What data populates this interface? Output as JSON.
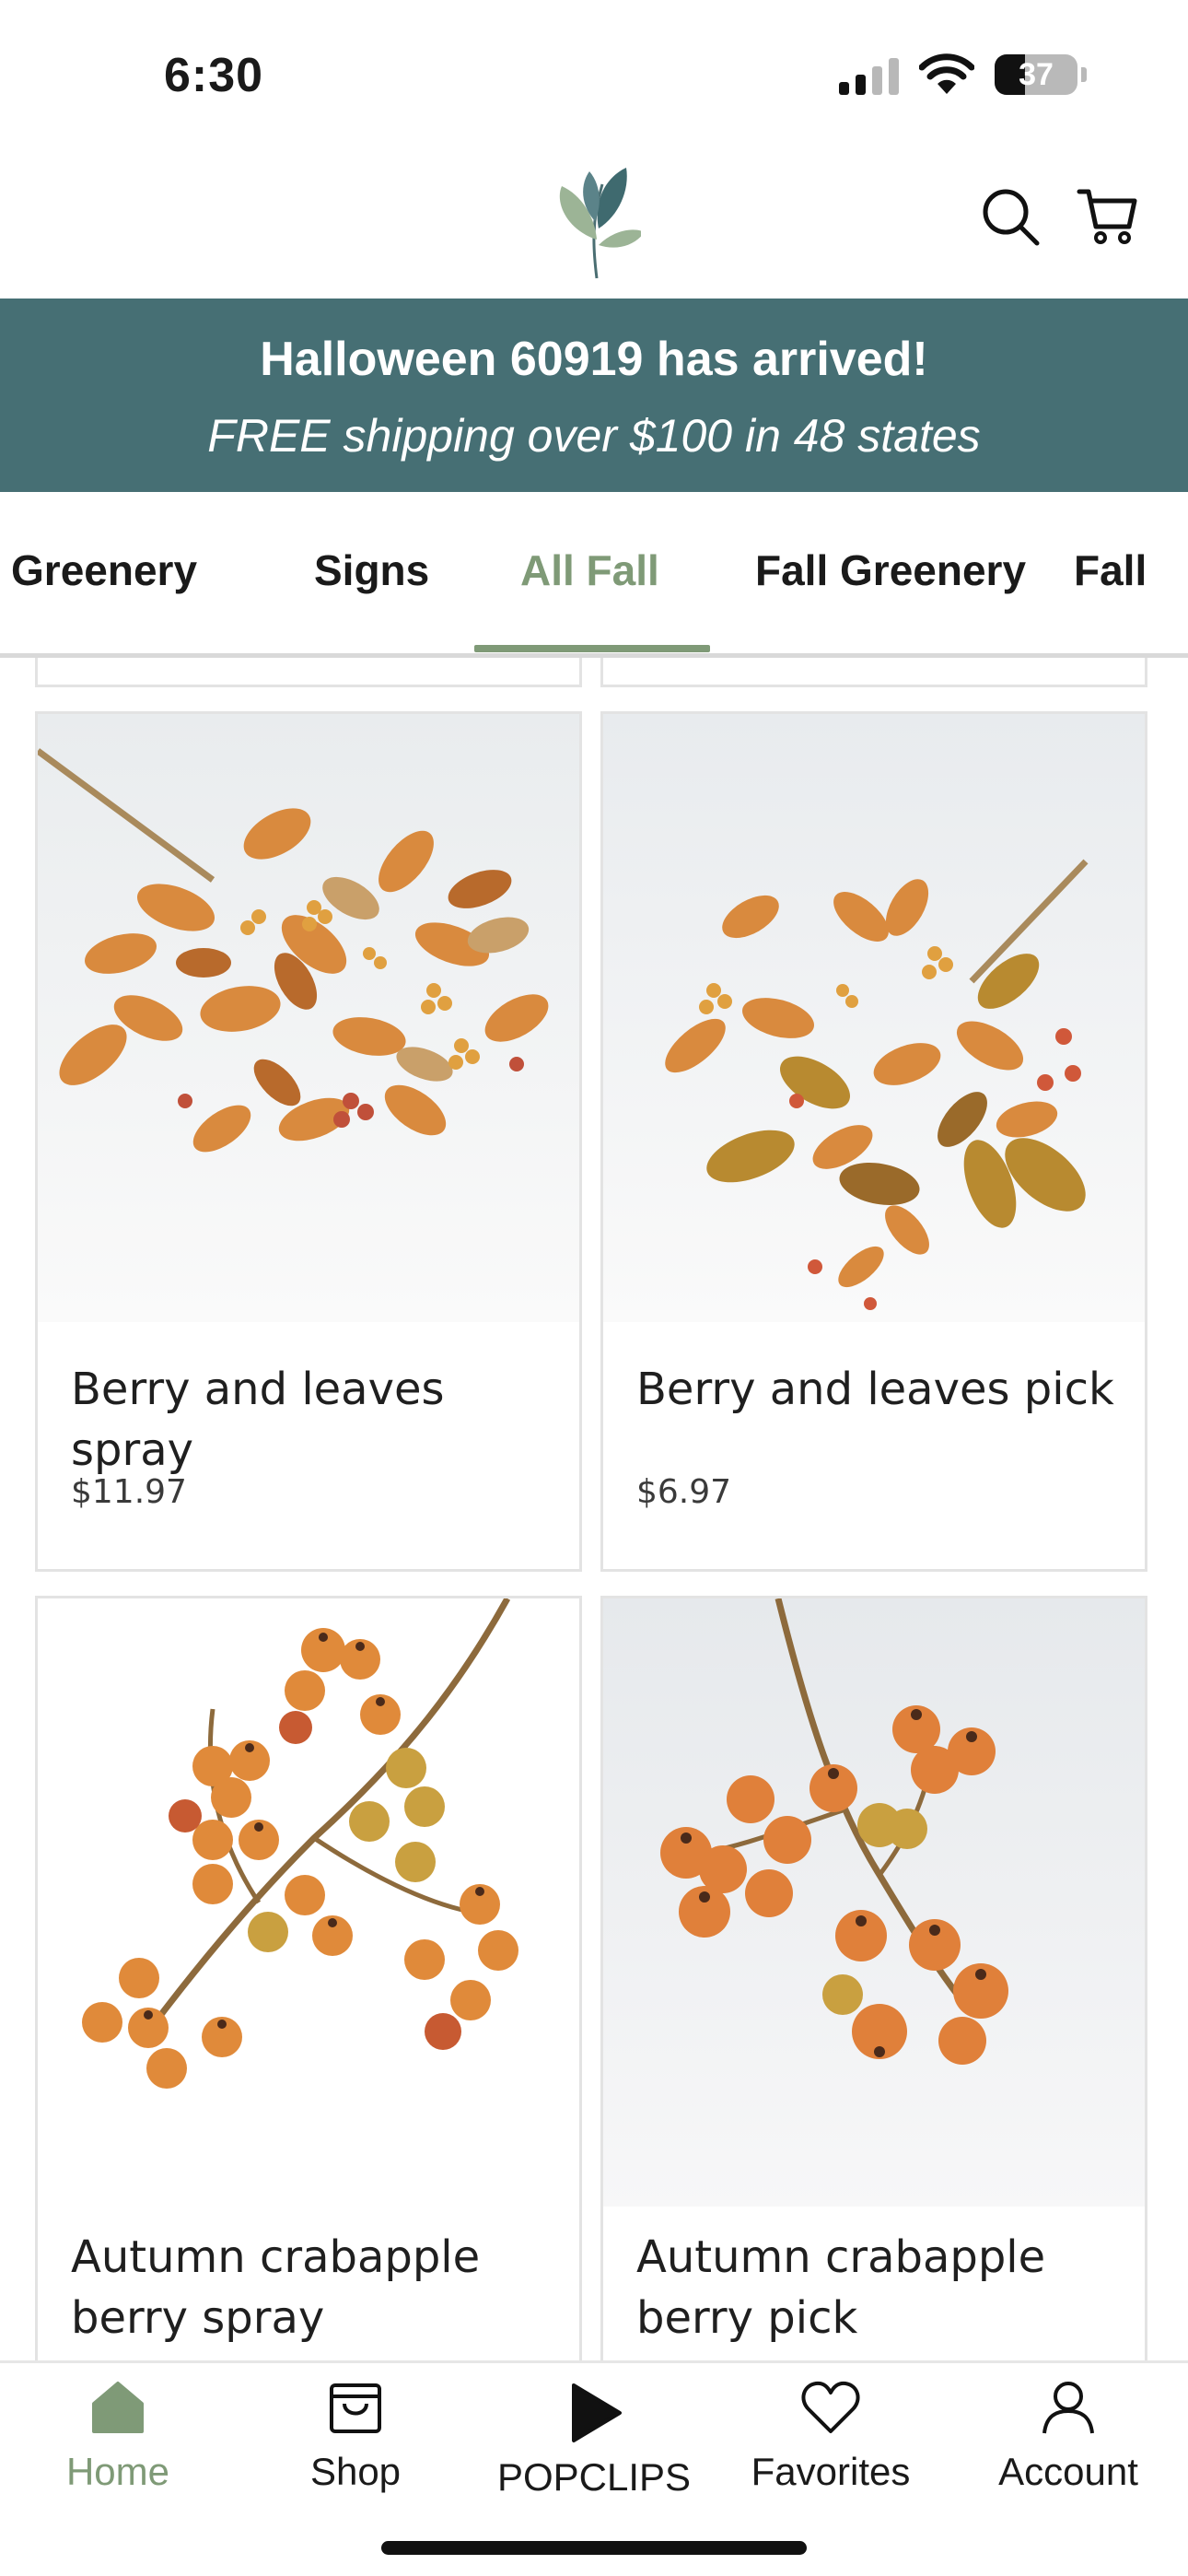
{
  "status_bar": {
    "time": "6:30",
    "battery_level": "37"
  },
  "header": {
    "logo_icon": "leaf-logo-icon",
    "search_icon": "search-icon",
    "cart_icon": "cart-icon"
  },
  "banner": {
    "title": "Halloween 60919 has arrived!",
    "subtitle": "FREE shipping over $100 in 48 states",
    "background_color": "#466f74"
  },
  "tabs": [
    {
      "label": "Fall Greenery"
    },
    {
      "label": "Signs"
    },
    {
      "label": "All Fall",
      "active": true
    },
    {
      "label": "Fall Greenery"
    },
    {
      "label": "Fall"
    }
  ],
  "products": [
    {
      "name": "Berry and leaves spray",
      "price": "$11.97"
    },
    {
      "name": "Berry and leaves pick",
      "price": "$6.97"
    },
    {
      "name": "Autumn crabapple berry spray",
      "price": ""
    },
    {
      "name": "Autumn crabapple berry pick",
      "price": ""
    }
  ],
  "bottom_nav": [
    {
      "label": "Home",
      "icon": "home-icon",
      "active": true
    },
    {
      "label": "Shop",
      "icon": "shopping-bag-icon"
    },
    {
      "label": "POPCLIPS",
      "icon": "play-icon"
    },
    {
      "label": "Favorites",
      "icon": "heart-icon"
    },
    {
      "label": "Account",
      "icon": "account-icon"
    }
  ],
  "colors": {
    "accent": "#7f9a77",
    "banner": "#466f74"
  }
}
